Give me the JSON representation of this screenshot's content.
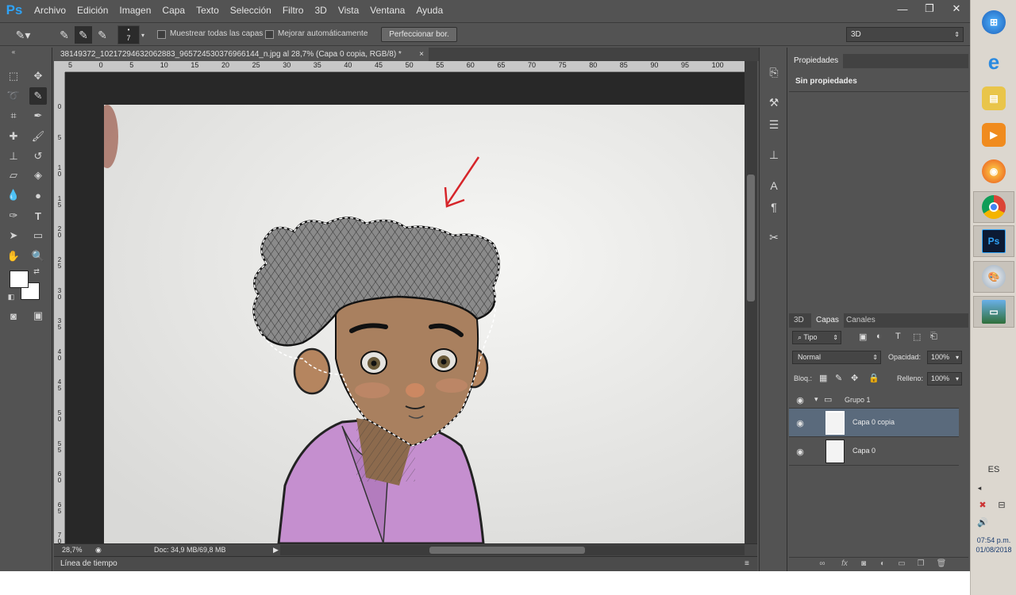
{
  "app": {
    "logo": "Ps",
    "menu": [
      "Archivo",
      "Edición",
      "Imagen",
      "Capa",
      "Texto",
      "Selección",
      "Filtro",
      "3D",
      "Vista",
      "Ventana",
      "Ayuda"
    ],
    "window_controls": [
      "—",
      "❐",
      "✕"
    ]
  },
  "options": {
    "brush_size": "7",
    "sample_all_label": "Muestrear todas las capas",
    "auto_enhance_label": "Mejorar automáticamente",
    "refine_button": "Perfeccionar bor.",
    "workspace": "3D"
  },
  "document": {
    "tab_title": "38149372_10217294632062883_9657245303769661 44_n.jpg al 28,7% (Capa 0 copia, RGB/8) *",
    "tab_title_exact": "38149372_10217294632062883_965724530376966144_n.jpg al 28,7% (Capa 0 copia, RGB/8) *",
    "zoom": "28,7%",
    "doc_size": "Doc: 34,9 MB/69,8 MB",
    "ruler_h": [
      "5",
      "0",
      "5",
      "10",
      "15",
      "20",
      "25",
      "30",
      "35",
      "40",
      "45",
      "50",
      "55",
      "60",
      "65",
      "70",
      "75",
      "80",
      "85",
      "90",
      "95",
      "100"
    ],
    "ruler_v": [
      "0",
      "5",
      "1 0",
      "1 5",
      "2 0",
      "2 5",
      "3 0",
      "3 5",
      "4 0",
      "4 5",
      "5 0",
      "5 5",
      "6 0",
      "6 5",
      "7 0"
    ]
  },
  "timeline": {
    "label": "Línea de tiempo"
  },
  "properties": {
    "tab": "Propiedades",
    "body": "Sin propiedades"
  },
  "layers_panel": {
    "tabs": [
      "3D",
      "Capas",
      "Canales"
    ],
    "active_tab": "Capas",
    "filter": "Tipo",
    "blend_mode": "Normal",
    "opacity_label": "Opacidad:",
    "opacity_value": "100%",
    "lock_label": "Bloq.:",
    "fill_label": "Relleno:",
    "fill_value": "100%",
    "group": "Grupo 1",
    "layers": [
      {
        "name": "Capa 0 copia",
        "selected": true
      },
      {
        "name": "Capa 0",
        "selected": false
      }
    ]
  },
  "taskbar": {
    "lang": "ES",
    "time": "07:54 p.m.",
    "date": "01/08/2018",
    "apps": [
      "windows-orb",
      "internet-explorer",
      "file-explorer",
      "media-player",
      "firefox",
      "chrome",
      "photoshop",
      "paint",
      "photo-viewer"
    ]
  },
  "colors": {
    "ui_bg": "#535353",
    "panel_dark": "#424242",
    "selected_layer": "#5a6a7c",
    "accent_ps": "#2fa3f7"
  }
}
